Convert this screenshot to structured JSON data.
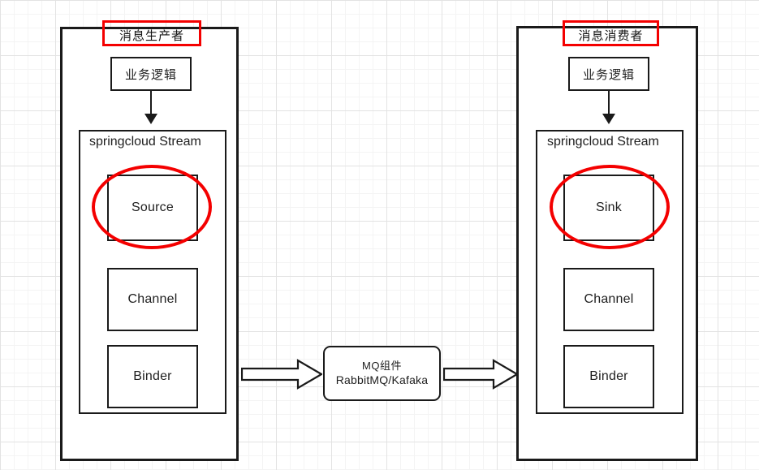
{
  "diagram": {
    "title_producer": "消息生产者",
    "title_consumer": "消息消费者",
    "colors": {
      "stroke": "#1a1a1a",
      "annotation": "#f40000",
      "grid_minor": "#f4f4f4",
      "grid_major": "#e3e3e3",
      "background": "#ffffff"
    },
    "producer": {
      "header_label": "消息生产者",
      "business_logic_label": "业务逻辑",
      "stream_label": "springcloud Stream",
      "nodes": [
        {
          "label": "Source",
          "highlighted": "true"
        },
        {
          "label": "Channel",
          "highlighted": "false"
        },
        {
          "label": "Binder",
          "highlighted": "false"
        }
      ]
    },
    "consumer": {
      "header_label": "消息消费者",
      "business_logic_label": "业务逻辑",
      "stream_label": "springcloud Stream",
      "nodes": [
        {
          "label": "Sink",
          "highlighted": "true"
        },
        {
          "label": "Channel",
          "highlighted": "false"
        },
        {
          "label": "Binder",
          "highlighted": "false"
        }
      ]
    },
    "middleware": {
      "line1": "MQ组件",
      "line2": "RabbitMQ/Kafaka"
    },
    "arrows": {
      "left_to_mq": "arrow-right-icon",
      "mq_to_right": "arrow-right-icon",
      "producer_flow_down": "arrow-down-icon",
      "consumer_flow_down": "arrow-down-icon"
    }
  }
}
